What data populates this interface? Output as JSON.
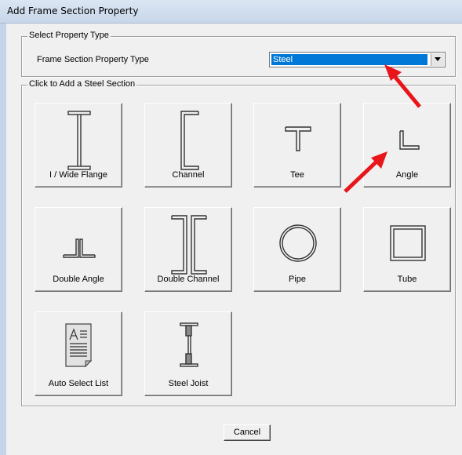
{
  "window": {
    "title": "Add Frame Section Property"
  },
  "property_type_group": {
    "legend": "Select Property Type",
    "field_label": "Frame Section Property Type",
    "selected_value": "Steel"
  },
  "sections_group": {
    "legend": "Click to Add a Steel Section",
    "tiles": [
      {
        "label": "I / Wide Flange",
        "icon": "i-wide-flange-icon"
      },
      {
        "label": "Channel",
        "icon": "channel-icon"
      },
      {
        "label": "Tee",
        "icon": "tee-icon"
      },
      {
        "label": "Angle",
        "icon": "angle-icon"
      },
      {
        "label": "Double Angle",
        "icon": "double-angle-icon"
      },
      {
        "label": "Double Channel",
        "icon": "double-channel-icon"
      },
      {
        "label": "Pipe",
        "icon": "pipe-icon"
      },
      {
        "label": "Tube",
        "icon": "tube-icon"
      },
      {
        "label": "Auto Select List",
        "icon": "auto-select-list-icon"
      },
      {
        "label": "Steel Joist",
        "icon": "steel-joist-icon"
      }
    ]
  },
  "buttons": {
    "cancel": "Cancel"
  },
  "annotation_color": "#e8151b"
}
